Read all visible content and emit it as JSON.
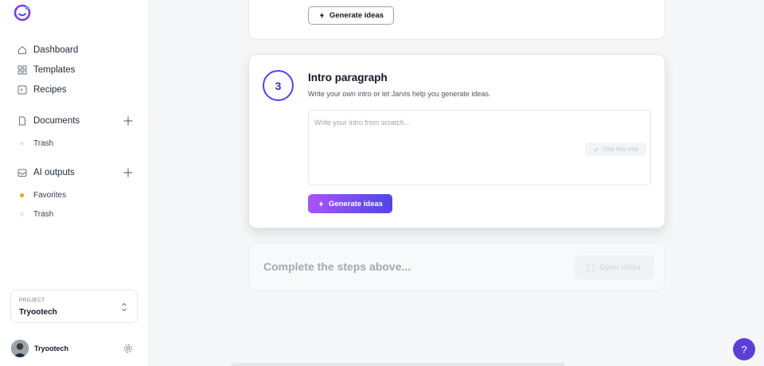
{
  "sidebar": {
    "nav": [
      {
        "label": "Dashboard",
        "icon": "home-icon"
      },
      {
        "label": "Templates",
        "icon": "grid-icon"
      },
      {
        "label": "Recipes",
        "icon": "terminal-icon"
      }
    ],
    "documents": {
      "label": "Documents",
      "trash_label": "Trash"
    },
    "ai_outputs": {
      "label": "AI outputs",
      "favorites_label": "Favorites",
      "trash_label": "Trash"
    },
    "project": {
      "caption": "PROJECT",
      "name": "Tryootech"
    },
    "user": {
      "name": "Tryootech"
    }
  },
  "top_card": {
    "button_label": "Generate ideas"
  },
  "step": {
    "number": "3",
    "title": "Intro paragraph",
    "subtitle": "Write your own intro or let Jarvis help you generate ideas.",
    "placeholder": "Write your intro from scratch...",
    "use_label": "Use this one",
    "generate_label": "Generate ideas"
  },
  "bottom": {
    "message": "Complete the steps above...",
    "open_label": "Open editor"
  },
  "help": {
    "label": "?"
  },
  "colors": {
    "accent": "#4f46e5",
    "gradient_start": "#a855f7",
    "favorites_dot": "#f59e0b"
  }
}
